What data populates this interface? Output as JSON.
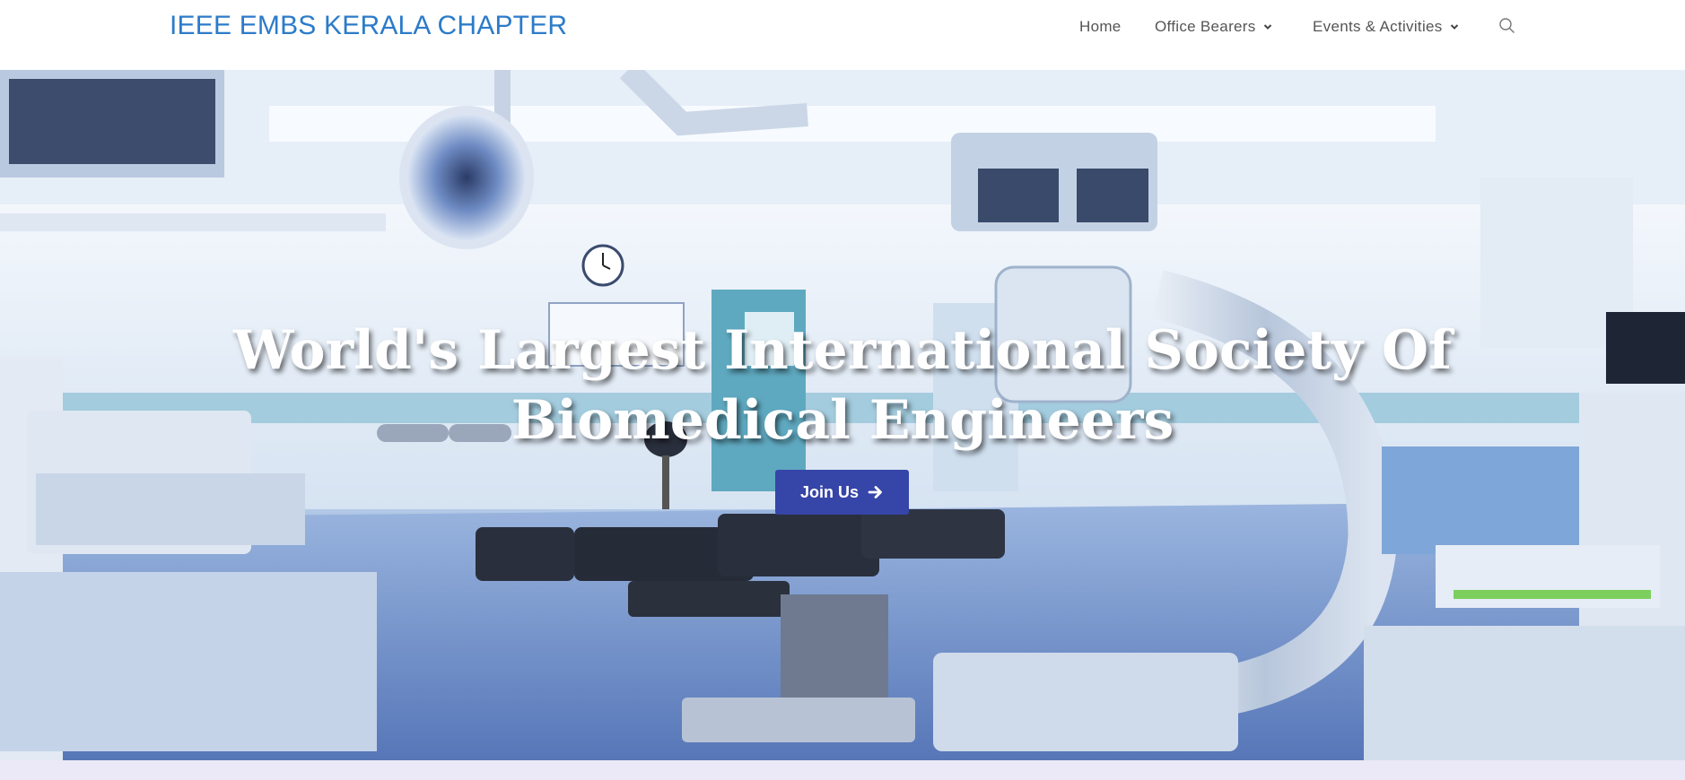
{
  "site": {
    "brand": "IEEE EMBS KERALA CHAPTER",
    "brand_color": "#2c7bc9"
  },
  "nav": {
    "items": [
      {
        "label": "Home",
        "has_dropdown": false
      },
      {
        "label": "Office Bearers",
        "has_dropdown": true
      },
      {
        "label": "Events & Activities",
        "has_dropdown": true
      }
    ],
    "search_icon": "search-icon"
  },
  "hero": {
    "title": "World's Largest International Society Of Biomedical Engineers",
    "background": "operating-room-photo",
    "cta": {
      "label": "Join Us",
      "icon": "arrow-right-icon",
      "color": "#3645a8"
    }
  },
  "footer_strip_color": "#ebe9f7"
}
